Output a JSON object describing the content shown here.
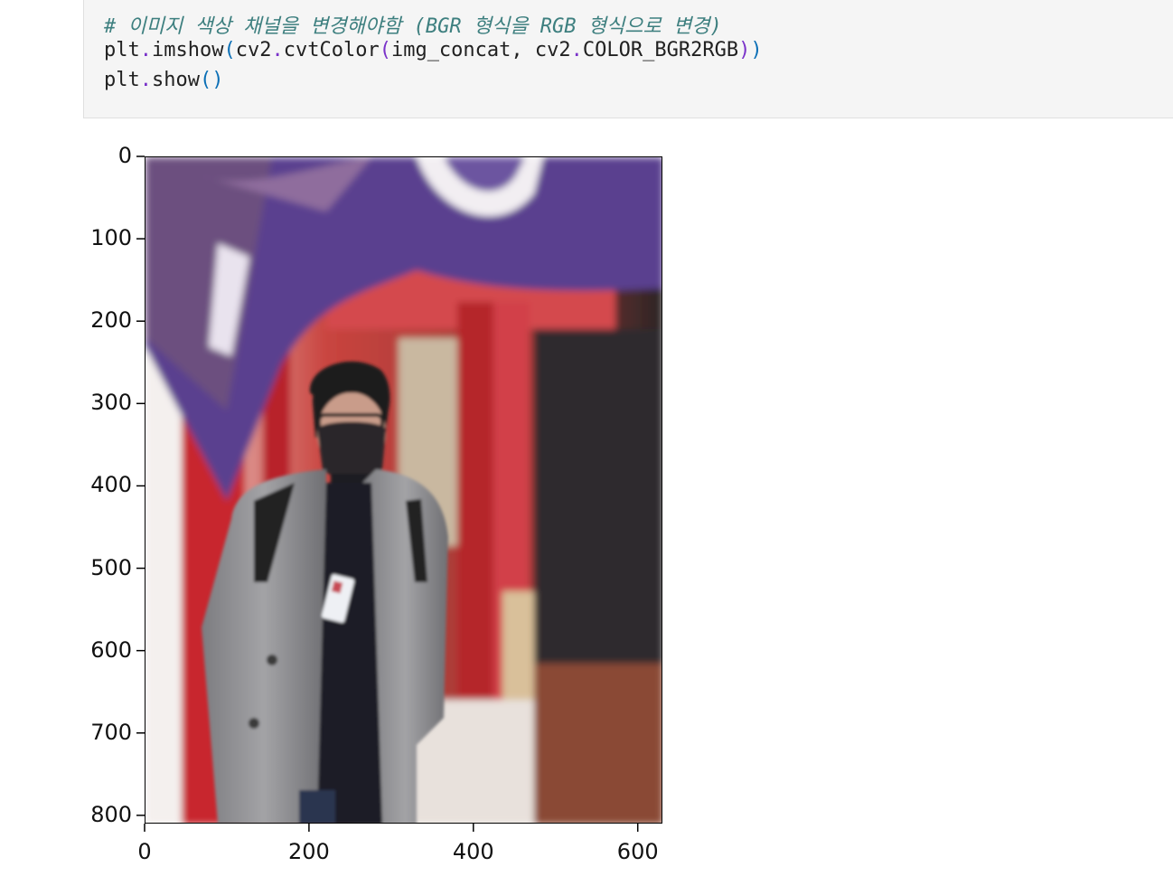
{
  "code_cell": {
    "comment_line": "# 이미지 색상 채널을 변경해야함 (BGR 형식을 RGB 형식으로 변경)",
    "line2": {
      "obj": "plt",
      "dot1": ".",
      "fn1": "imshow",
      "paren_open": "(",
      "arg_obj": "cv2",
      "dot2": ".",
      "fn2": "cvtColor",
      "paren2_open": "(",
      "args": "img_concat, cv2",
      "dot3": ".",
      "const": "COLOR_BGR2RGB",
      "paren2_close": ")",
      "paren_close": ")"
    },
    "line3": {
      "obj": "plt",
      "dot": ".",
      "fn": "show",
      "parens": "()"
    }
  },
  "chart_data": {
    "type": "image",
    "xlabel": "",
    "ylabel": "",
    "x_ticks": [
      "0",
      "200",
      "400",
      "600"
    ],
    "y_ticks": [
      "0",
      "100",
      "200",
      "300",
      "400",
      "500",
      "600",
      "700",
      "800"
    ],
    "xlim": [
      0,
      630
    ],
    "ylim": [
      810,
      0
    ],
    "image_subject": "person in grey coat and black mask standing in front of red shrine pillars with purple banner"
  }
}
